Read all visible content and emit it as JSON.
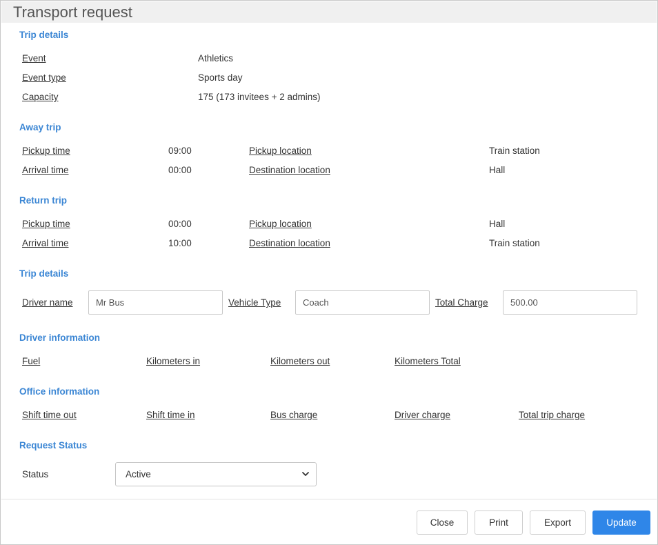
{
  "title": "Transport request",
  "trip_details": {
    "heading": "Trip details",
    "rows": [
      {
        "label": "Event",
        "value": "Athletics"
      },
      {
        "label": "Event type",
        "value": "Sports day"
      },
      {
        "label": "Capacity",
        "value": "175 (173 invitees + 2 admins)"
      }
    ]
  },
  "away_trip": {
    "heading": "Away trip",
    "pickup_time_label": "Pickup time",
    "pickup_time": "09:00",
    "pickup_location_label": "Pickup location",
    "pickup_location": "Train station",
    "arrival_time_label": "Arrival time",
    "arrival_time": "00:00",
    "destination_location_label": "Destination location",
    "destination_location": "Hall"
  },
  "return_trip": {
    "heading": "Return trip",
    "pickup_time_label": "Pickup time",
    "pickup_time": "00:00",
    "pickup_location_label": "Pickup location",
    "pickup_location": "Hall",
    "arrival_time_label": "Arrival time",
    "arrival_time": "10:00",
    "destination_location_label": "Destination location",
    "destination_location": "Train station"
  },
  "trip_details_form": {
    "heading": "Trip details",
    "driver_name_label": "Driver name",
    "driver_name_value": "Mr Bus",
    "vehicle_type_label": "Vehicle Type",
    "vehicle_type_value": "Coach",
    "total_charge_label": "Total Charge",
    "total_charge_value": "500.00"
  },
  "driver_information": {
    "heading": "Driver information",
    "fields": [
      "Fuel",
      "Kilometers in",
      "Kilometers out",
      "Kilometers Total"
    ]
  },
  "office_information": {
    "heading": "Office information",
    "fields": [
      "Shift time out",
      "Shift time in",
      "Bus charge",
      "Driver charge",
      "Total trip charge"
    ]
  },
  "request_status": {
    "heading": "Request Status",
    "status_label": "Status",
    "status_value": "Active"
  },
  "footer": {
    "close_label": "Close",
    "print_label": "Print",
    "export_label": "Export",
    "update_label": "Update"
  },
  "colors": {
    "accent": "#3b86d4",
    "primary_button": "#2f86e8",
    "titlebar": "#f0f0f0"
  },
  "icons": {
    "status_dropdown": "chevron-down-icon"
  }
}
